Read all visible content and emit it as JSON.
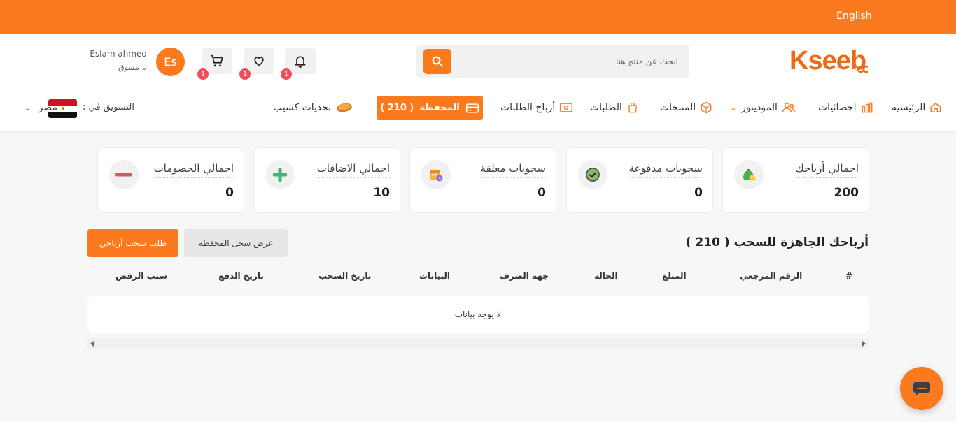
{
  "topbar": {
    "language": "English"
  },
  "header": {
    "logo_text": "Kseeb",
    "search": {
      "placeholder": "ابحث عن منتج هنا"
    },
    "notifications": {
      "count": "1"
    },
    "wishlist": {
      "count": "1"
    },
    "cart": {
      "count": "1"
    },
    "user": {
      "initials": "Es",
      "name": "Eslam ahmed",
      "role": "مسوق"
    }
  },
  "nav": {
    "home": "الرئيسية",
    "stats": "احصائيات",
    "moderator": "الموديتور",
    "products": "المنتجات",
    "orders": "الطلبات",
    "order_profits": "أرباح الطلبات",
    "wallet": "المحفظة",
    "wallet_count": "( 210 )",
    "challenges": "تحديات كسيب",
    "market_label": "التسويق في :",
    "country": "مصر"
  },
  "colors": {
    "accent": "#fa7a1d",
    "badge": "#f04d5f"
  },
  "cards": [
    {
      "label": "اجمالي أرباحك",
      "value": "200",
      "icon": "money-bag-icon"
    },
    {
      "label": "سحوبات مدفوعة",
      "value": "0",
      "icon": "check-circle-icon"
    },
    {
      "label": "سحوبات معلقة",
      "value": "0",
      "icon": "calendar-clock-icon"
    },
    {
      "label": "اجمالي الاضافات",
      "value": "10",
      "icon": "plus-icon"
    },
    {
      "label": "اجمالي الخصومات",
      "value": "0",
      "icon": "minus-icon"
    }
  ],
  "section": {
    "title": "أرباحك الجاهزة للسحب ( 210 )",
    "history_button": "عرض سجل المحفظة",
    "withdraw_button": "طلب سحب أرباحي"
  },
  "table": {
    "columns": [
      "#",
      "الرقم المرجعي",
      "المبلغ",
      "الحالة",
      "جهة الصرف",
      "البيانات",
      "تاريخ السحب",
      "تاريخ الدفع",
      "سبب الرفض"
    ],
    "empty_text": "لا يوجد بيانات"
  }
}
